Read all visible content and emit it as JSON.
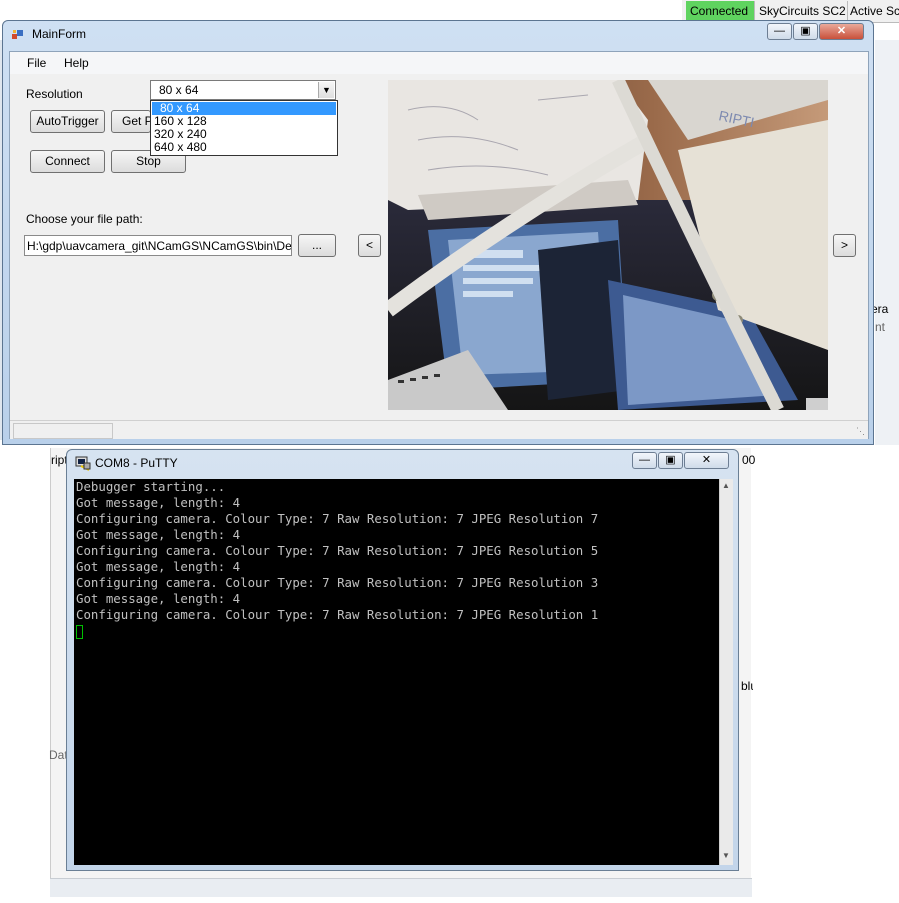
{
  "background": {
    "tabs": [
      "Connected",
      "SkyCircuits SC2",
      "Active Sc"
    ],
    "fragments": [
      "ript",
      "00",
      "era",
      "nt",
      "blu",
      "Dat"
    ]
  },
  "mainform": {
    "title": "MainForm",
    "menu": [
      "File",
      "Help"
    ],
    "resolution_label": "Resolution",
    "resolution_selected": "80 x 64",
    "resolution_options": [
      "80 x 64",
      "160 x 128",
      "320 x 240",
      "640 x 480"
    ],
    "autotrigger_label": "AutoTrigger",
    "getpicture_label": "Get P",
    "connect_label": "Connect",
    "stop_label": "Stop",
    "filepath_label": "Choose your file path:",
    "filepath_value": "H:\\gdp\\uavcamera_git\\NCamGS\\NCamGS\\bin\\Debug",
    "browse_label": "...",
    "prev_label": "<",
    "next_label": ">"
  },
  "putty": {
    "title": "COM8 - PuTTY",
    "lines": [
      "Debugger starting...",
      "Got message, length: 4",
      "Configuring camera. Colour Type: 7 Raw Resolution: 7 JPEG Resolution 7",
      "Got message, length: 4",
      "Configuring camera. Colour Type: 7 Raw Resolution: 7 JPEG Resolution 5",
      "Got message, length: 4",
      "Configuring camera. Colour Type: 7 Raw Resolution: 7 JPEG Resolution 3",
      "Got message, length: 4",
      "Configuring camera. Colour Type: 7 Raw Resolution: 7 JPEG Resolution 1"
    ]
  },
  "colors": {
    "connected_tab": "#5fd35f",
    "selection": "#3399ff",
    "terminal_bg": "#000000",
    "terminal_fg": "#c0c0c0",
    "cursor": "#00c000"
  }
}
